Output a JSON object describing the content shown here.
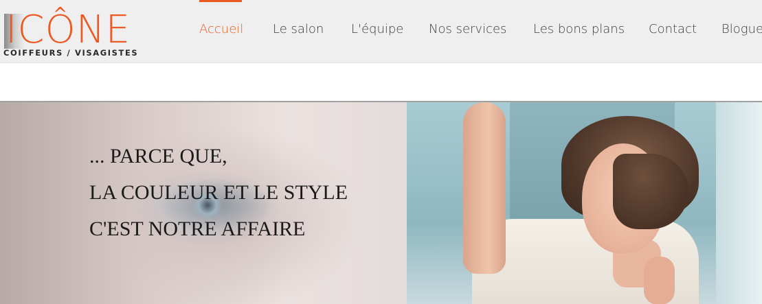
{
  "logo": {
    "title": "ICÔNE",
    "subtitle": "COIFFEURS / VISAGISTES"
  },
  "nav": {
    "items": [
      {
        "label": "Accueil",
        "active": true
      },
      {
        "label": "Le salon",
        "active": false
      },
      {
        "label": "L'équipe",
        "active": false
      },
      {
        "label": "Nos services",
        "active": false
      },
      {
        "label": "Les bons plans",
        "active": false
      },
      {
        "label": "Contact",
        "active": false
      },
      {
        "label": "Blogue",
        "active": false
      }
    ]
  },
  "hero": {
    "lines": [
      "... PARCE QUE,",
      "LA COULEUR ET LE STYLE",
      "C'EST NOTRE AFFAIRE"
    ]
  },
  "colors": {
    "accent": "#ec5a24",
    "nav_text": "#3c3c3c",
    "header_bg": "#efefef"
  }
}
